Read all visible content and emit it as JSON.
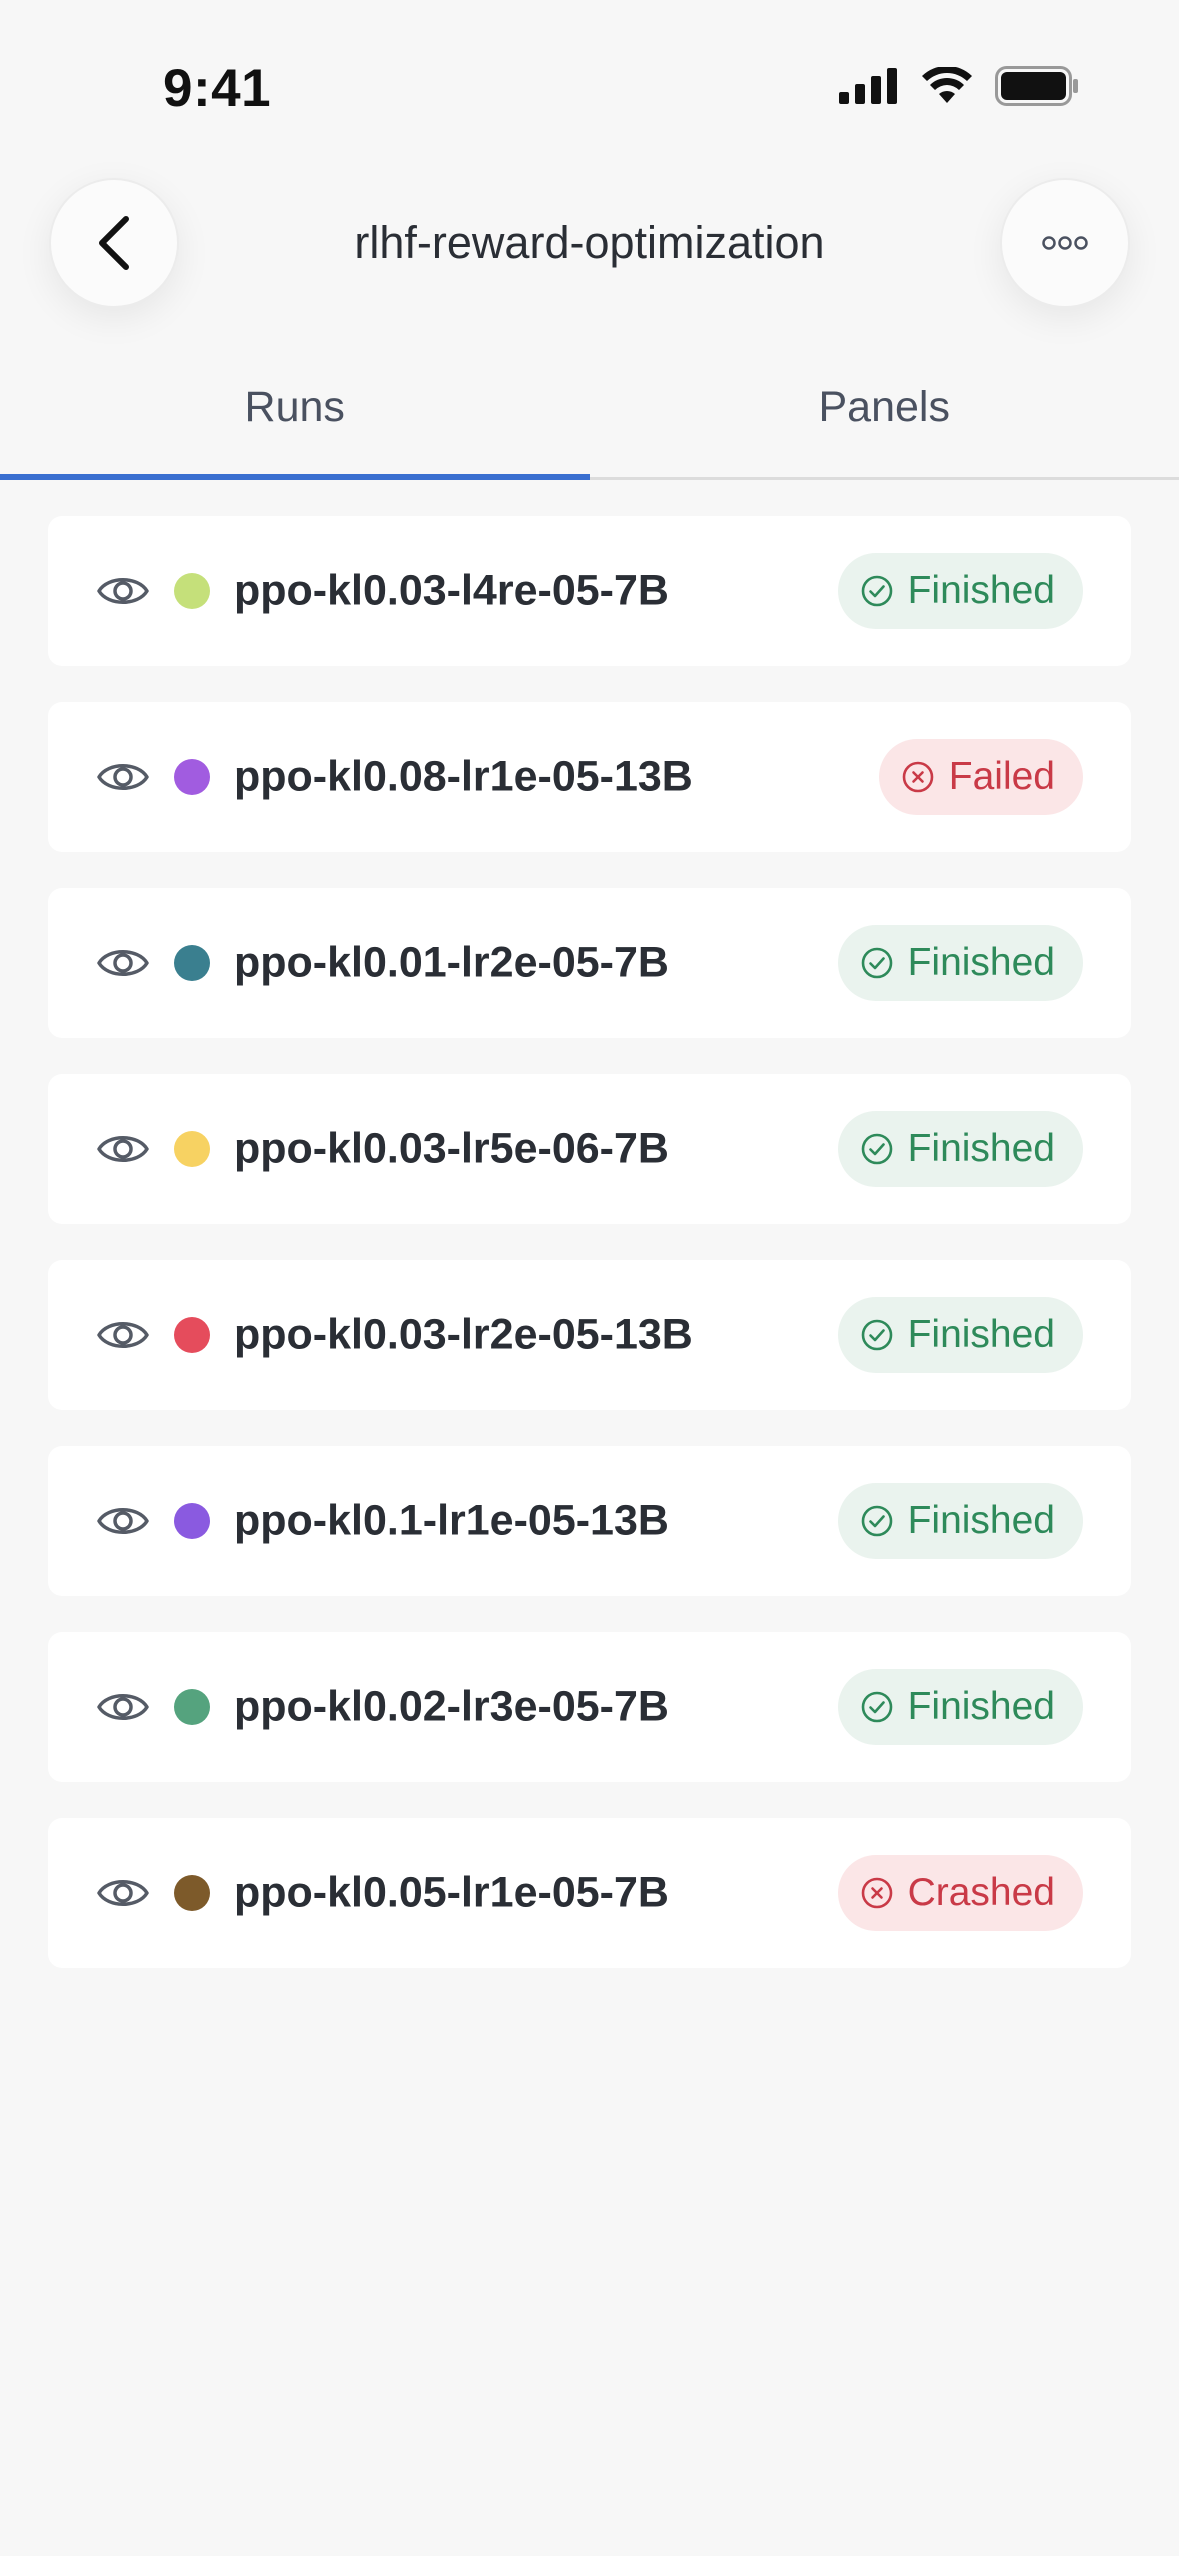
{
  "status_bar": {
    "time": "9:41"
  },
  "header": {
    "title": "rlhf-reward-optimization",
    "back_icon": "chevron-left-icon",
    "more_icon": "more-horizontal-icon"
  },
  "tabs": [
    {
      "label": "Runs",
      "active": true
    },
    {
      "label": "Panels",
      "active": false
    }
  ],
  "runs": [
    {
      "name": "ppo-kl0.03-l4re-05-7B",
      "color": "#c5e07a",
      "status": "Finished",
      "state": "finished"
    },
    {
      "name": "ppo-kl0.08-lr1e-05-13B",
      "color": "#a15ce0",
      "status": "Failed",
      "state": "failed"
    },
    {
      "name": "ppo-kl0.01-lr2e-05-7B",
      "color": "#3a7f8f",
      "status": "Finished",
      "state": "finished"
    },
    {
      "name": "ppo-kl0.03-lr5e-06-7B",
      "color": "#f7d262",
      "status": "Finished",
      "state": "finished"
    },
    {
      "name": "ppo-kl0.03-lr2e-05-13B",
      "color": "#e54c5c",
      "status": "Finished",
      "state": "finished"
    },
    {
      "name": "ppo-kl0.1-lr1e-05-13B",
      "color": "#8a5ae0",
      "status": "Finished",
      "state": "finished"
    },
    {
      "name": "ppo-kl0.02-lr3e-05-7B",
      "color": "#55a37e",
      "status": "Finished",
      "state": "finished"
    },
    {
      "name": "ppo-kl0.05-lr1e-05-7B",
      "color": "#7d5a2a",
      "status": "Crashed",
      "state": "failed"
    }
  ],
  "colors": {
    "accent": "#3a6fd0",
    "finished_text": "#2e8a5a",
    "finished_bg": "#eaf3ee",
    "failed_text": "#c93a47",
    "failed_bg": "#fbe6e7"
  }
}
